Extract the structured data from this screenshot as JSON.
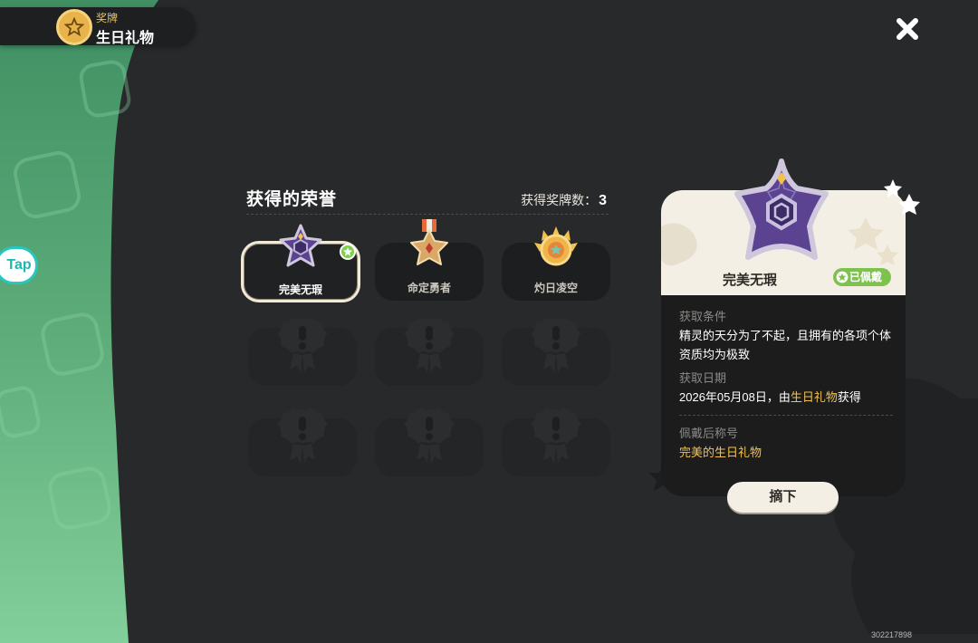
{
  "header": {
    "subtitle": "奖牌",
    "title": "生日礼物"
  },
  "left_button": {
    "label": "Tap"
  },
  "honors": {
    "title": "获得的荣誉",
    "count_label": "获得奖牌数：",
    "count_value": "3",
    "medals": [
      {
        "label": "完美无瑕",
        "state": "selected-equipped"
      },
      {
        "label": "命定勇者",
        "state": "unlocked"
      },
      {
        "label": "灼日凌空",
        "state": "unlocked"
      },
      {
        "label": "",
        "state": "locked"
      },
      {
        "label": "",
        "state": "locked"
      },
      {
        "label": "",
        "state": "locked"
      },
      {
        "label": "",
        "state": "locked"
      },
      {
        "label": "",
        "state": "locked"
      },
      {
        "label": "",
        "state": "locked"
      }
    ]
  },
  "detail": {
    "name": "完美无瑕",
    "equipped_badge": "已佩戴",
    "condition_label": "获取条件",
    "condition_text": "精灵的天分为了不起，且拥有的各项个体资质均为极致",
    "date_label": "获取日期",
    "date_prefix": "2026年05月08日，由",
    "date_source": "生日礼物",
    "date_suffix": "获得",
    "title_label": "佩戴后称号",
    "title_text": "完美的生日礼物"
  },
  "remove_button": {
    "label": "摘下"
  },
  "build_id": "302217898",
  "colors": {
    "background": "#27292a",
    "accent_gold": "#f2c24d",
    "equipped_green": "#7ec24e",
    "card_cream": "#f3efe4",
    "backdrop_green": "#7ecb95"
  },
  "icons": [
    "star-badge-icon",
    "close-icon",
    "medal-perfect-icon",
    "medal-hero-icon",
    "medal-sun-icon",
    "locked-medal-icon",
    "check-star-icon"
  ]
}
